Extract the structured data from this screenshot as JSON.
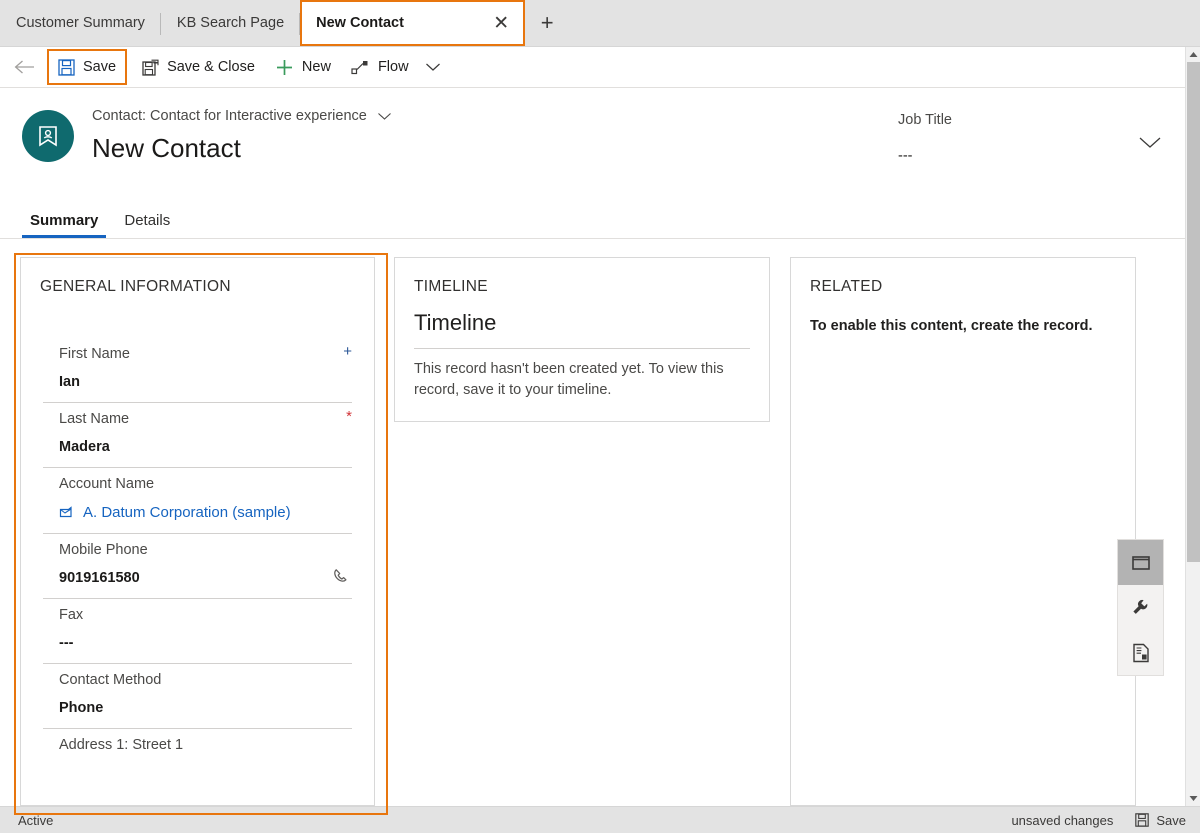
{
  "tabs": {
    "items": [
      {
        "label": "Customer Summary",
        "active": false
      },
      {
        "label": "KB Search Page",
        "active": false
      },
      {
        "label": "New Contact",
        "active": true
      }
    ],
    "close_glyph": "✕",
    "new_tab_glyph": "+"
  },
  "command_bar": {
    "back_label": "Back",
    "save_label": "Save",
    "save_close_label": "Save & Close",
    "new_label": "New",
    "flow_label": "Flow"
  },
  "record_header": {
    "entity_line": "Contact: Contact for Interactive experience",
    "record_name": "New Contact",
    "header_field_label": "Job Title",
    "header_field_value": "---"
  },
  "form_tabs": [
    {
      "label": "Summary",
      "selected": true
    },
    {
      "label": "Details",
      "selected": false
    }
  ],
  "general_information": {
    "section_title": "GENERAL INFORMATION",
    "fields": [
      {
        "label": "First Name",
        "value": "Ian",
        "marker": "+",
        "marker_kind": "plus",
        "icon": "",
        "link": false
      },
      {
        "label": "Last Name",
        "value": "Madera",
        "marker": "*",
        "marker_kind": "star",
        "icon": "",
        "link": false
      },
      {
        "label": "Account Name",
        "value": "A. Datum Corporation (sample)",
        "marker": "",
        "marker_kind": "",
        "icon": "account-lookup-icon",
        "link": true
      },
      {
        "label": "Mobile Phone",
        "value": "9019161580",
        "marker": "",
        "marker_kind": "",
        "icon": "phone-icon",
        "link": false
      },
      {
        "label": "Fax",
        "value": "---",
        "marker": "",
        "marker_kind": "",
        "icon": "",
        "link": false
      },
      {
        "label": "Contact Method",
        "value": "Phone",
        "marker": "",
        "marker_kind": "",
        "icon": "",
        "link": false
      },
      {
        "label": "Address 1: Street 1",
        "value": "",
        "marker": "",
        "marker_kind": "",
        "icon": "",
        "link": false
      }
    ]
  },
  "timeline": {
    "section_title": "TIMELINE",
    "heading": "Timeline",
    "empty_message": "This record hasn't been created yet.  To view this record, save it to your timeline."
  },
  "related": {
    "section_title": "RELATED",
    "empty_message": "To enable this content, create the record.",
    "rail_items": [
      {
        "name": "window-icon",
        "selected": true
      },
      {
        "name": "wrench-icon",
        "selected": false
      },
      {
        "name": "report-icon",
        "selected": false
      }
    ]
  },
  "status_bar": {
    "left_text": "Active",
    "unsaved_text": "unsaved changes",
    "save_label": "Save"
  },
  "colors": {
    "accent_orange": "#e8760e",
    "accent_blue": "#1664c0",
    "avatar_teal": "#0f6a6e",
    "required_red": "#d13438",
    "optional_blue": "#2b5797",
    "new_green": "#3a9b5c"
  }
}
